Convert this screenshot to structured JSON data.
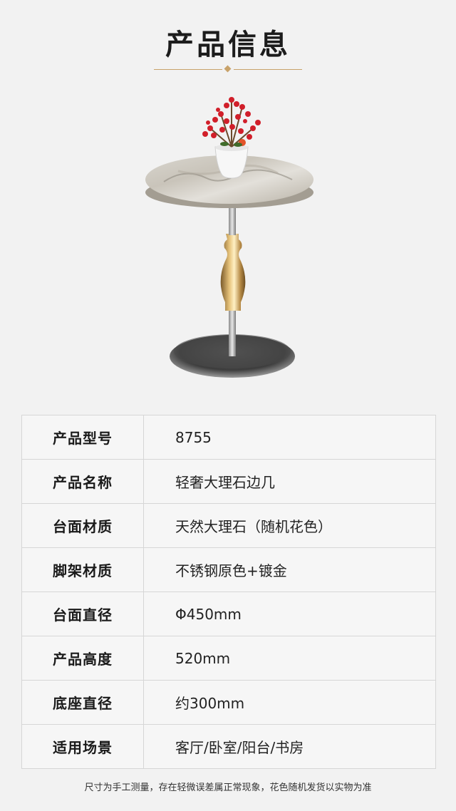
{
  "header": {
    "title": "产品信息"
  },
  "specs": [
    {
      "label": "产品型号",
      "value": "8755"
    },
    {
      "label": "产品名称",
      "value": "轻奢大理石边几"
    },
    {
      "label": "台面材质",
      "value": "天然大理石（随机花色）"
    },
    {
      "label": "脚架材质",
      "value": "不锈钢原色+镀金"
    },
    {
      "label": "台面直径",
      "value": "Φ450mm"
    },
    {
      "label": "产品高度",
      "value": "520mm"
    },
    {
      "label": "底座直径",
      "value": "约300mm"
    },
    {
      "label": "适用场景",
      "value": "客厅/卧室/阳台/书房"
    }
  ],
  "footer": {
    "note": "尺寸为手工测量，存在轻微误差属正常现象，花色随机发货以实物为准"
  },
  "colors": {
    "accent_gold": "#c8a26a",
    "background": "#f2f2f2",
    "border": "#d6d6d6"
  }
}
